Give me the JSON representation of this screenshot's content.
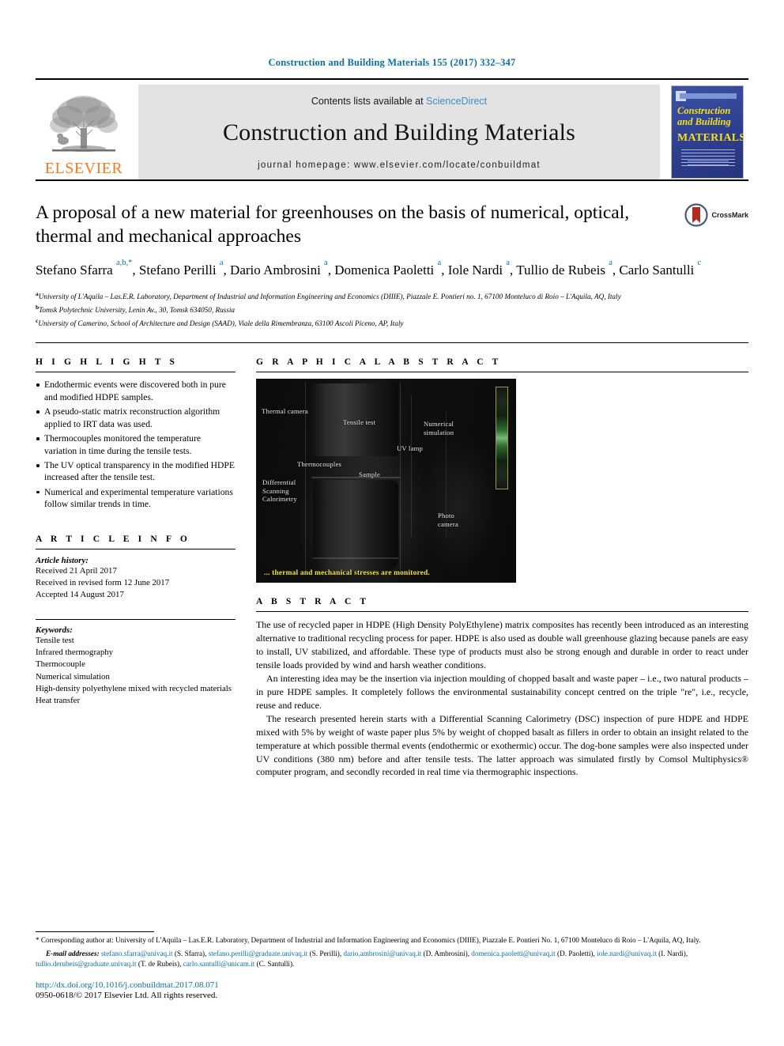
{
  "running_head": "Construction and Building Materials 155 (2017) 332–347",
  "masthead": {
    "contents_prefix": "Contents lists available at ",
    "sciencedirect": "ScienceDirect",
    "journal_title": "Construction and Building Materials",
    "homepage": "journal homepage: www.elsevier.com/locate/conbuildmat",
    "publisher_logo_label": "ELSEVIER",
    "cover": {
      "line1": "Construction",
      "line2": "and Building",
      "line3": "MATERIALS"
    }
  },
  "article": {
    "title": "A proposal of a new material for greenhouses on the basis of numerical, optical, thermal and mechanical approaches",
    "crossmark_label": "CrossMark",
    "authors_html": "Stefano Sfarra <sup>a,b,*</sup>, Stefano Perilli <sup>a</sup>, Dario Ambrosini <sup>a</sup>, Domenica Paoletti <sup>a</sup>, Iole Nardi <sup>a</sup>, Tullio de Rubeis <sup>a</sup>, Carlo Santulli <sup>c</sup>",
    "affiliations": [
      "University of L'Aquila – Las.E.R. Laboratory, Department of Industrial and Information Engineering and Economics (DIIIE), Piazzale E. Pontieri no. 1, 67100 Monteluco di Roio – L'Aquila, AQ, Italy",
      "Tomsk Polytechnic University, Lenin Av., 30, Tomsk 634050, Russia",
      "University of Camerino, School of Architecture and Design (SAAD), Viale della Rimembranza, 63100 Ascoli Piceno, AP, Italy"
    ],
    "affiliation_markers": [
      "a",
      "b",
      "c"
    ]
  },
  "highlights": {
    "heading": "H I G H L I G H T S",
    "items": [
      "Endothermic events were discovered both in pure and modified HDPE samples.",
      "A pseudo-static matrix reconstruction algorithm applied to IRT data was used.",
      "Thermocouples monitored the temperature variation in time during the tensile tests.",
      "The UV optical transparency in the modified HDPE increased after the tensile test.",
      "Numerical and experimental temperature variations follow similar trends in time."
    ]
  },
  "article_info": {
    "heading": "A R T I C L E    I N F O",
    "history_label": "Article history:",
    "history": [
      "Received 21 April 2017",
      "Received in revised form 12 June 2017",
      "Accepted 14 August 2017"
    ],
    "keywords_label": "Keywords:",
    "keywords": [
      "Tensile test",
      "Infrared thermography",
      "Thermocouple",
      "Numerical simulation",
      "High-density polyethylene mixed with recycled materials",
      "Heat transfer"
    ]
  },
  "graphical_abstract": {
    "heading": "G R A P H I C A L   A B S T R A C T",
    "image_labels": [
      "Thermal camera",
      "Tensile test",
      "Numerical simulation",
      "Thermocouples",
      "UV lamp",
      "Sample",
      "Differential Scanning Calorimetry",
      "Photo camera"
    ],
    "caption": "... thermal and mechanical stresses are monitored.",
    "caption_color": "#f2e63c"
  },
  "abstract": {
    "heading": "A B S T R A C T",
    "paragraphs": [
      "The use of recycled paper in HDPE (High Density PolyEthylene) matrix composites has recently been introduced as an interesting alternative to traditional recycling process for paper. HDPE is also used as double wall greenhouse glazing because panels are easy to install, UV stabilized, and affordable. These type of products must also be strong enough and durable in order to react under tensile loads provided by wind and harsh weather conditions.",
      "An interesting idea may be the insertion via injection moulding of chopped basalt and waste paper – i.e., two natural products – in pure HDPE samples. It completely follows the environmental sustainability concept centred on the triple \"re\", i.e., recycle, reuse and reduce.",
      "The research presented herein starts with a Differential Scanning Calorimetry (DSC) inspection of pure HDPE and HDPE mixed with 5% by weight of waste paper plus 5% by weight of chopped basalt as fillers in order to obtain an insight related to the temperature at which possible thermal events (endothermic or exothermic) occur. The dog-bone samples were also inspected under UV conditions (380 nm) before and after tensile tests. The latter approach was simulated firstly by Comsol Multiphysics® computer program, and secondly recorded in real time via thermographic inspections."
    ]
  },
  "footer": {
    "corresponding": "* Corresponding author at: University of L'Aquila – Las.E.R. Laboratory, Department of Industrial and Information Engineering and Economics (DIIIE), Piazzale E. Pontieri No. 1, 67100 Monteluco di Roio – L'Aquila, AQ, Italy.",
    "email_label": "E-mail addresses:",
    "emails": [
      {
        "address": "stefano.sfarra@univaq.it",
        "person": "(S. Sfarra)"
      },
      {
        "address": "stefano.perilli@graduate.univaq.it",
        "person": "(S. Perilli)"
      },
      {
        "address": "dario.ambrosini@univaq.it",
        "person": "(D. Ambrosini)"
      },
      {
        "address": "domenica.paoletti@univaq.it",
        "person": "(D. Paoletti)"
      },
      {
        "address": "iole.nardi@univaq.it",
        "person": "(I. Nardi)"
      },
      {
        "address": "tullio.derubeis@graduate.univaq.it",
        "person": "(T. de Rubeis)"
      },
      {
        "address": "carlo.santulli@unicam.it",
        "person": "(C. Santulli)"
      }
    ],
    "doi": "http://dx.doi.org/10.1016/j.conbuildmat.2017.08.071",
    "copyright": "0950-0618/© 2017 Elsevier Ltd. All rights reserved."
  },
  "colors": {
    "link_blue": "#0a71a8",
    "sciencedirect_blue": "#3d8ec9",
    "elsevier_orange": "#f47a20",
    "cover_blue": "#2e3f8f",
    "cover_yellow": "#f4e01e",
    "crossmark_red": "#b02b22"
  }
}
